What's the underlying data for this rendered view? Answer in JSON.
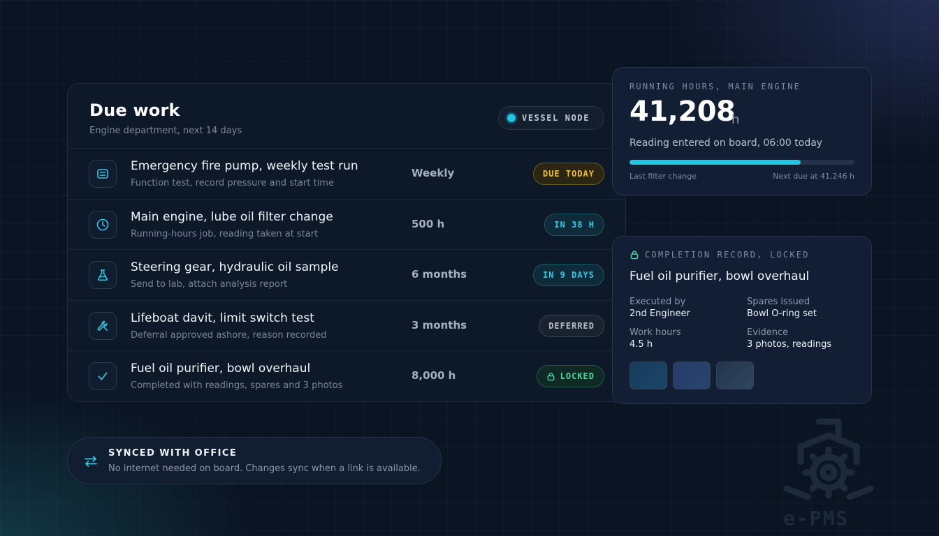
{
  "due_work": {
    "title": "Due work",
    "subtitle": "Engine department, next 14 days",
    "node_badge": "VESSEL NODE",
    "items": [
      {
        "icon": "list-icon",
        "title": "Emergency fire pump, weekly test run",
        "subtitle": "Function test, record pressure and start time",
        "interval": "Weekly",
        "status": "DUE TODAY",
        "status_type": "due"
      },
      {
        "icon": "clock-icon",
        "title": "Main engine, lube oil filter change",
        "subtitle": "Running-hours job, reading taken at start",
        "interval": "500 h",
        "status": "IN 38 H",
        "status_type": "in"
      },
      {
        "icon": "flask-icon",
        "title": "Steering gear, hydraulic oil sample",
        "subtitle": "Send to lab, attach analysis report",
        "interval": "6 months",
        "status": "IN 9 DAYS",
        "status_type": "in"
      },
      {
        "icon": "wrench-icon",
        "title": "Lifeboat davit, limit switch test",
        "subtitle": "Deferral approved ashore, reason recorded",
        "interval": "3 months",
        "status": "DEFERRED",
        "status_type": "deferred"
      },
      {
        "icon": "check-icon",
        "title": "Fuel oil purifier, bowl overhaul",
        "subtitle": "Completed with readings, spares and 3 photos",
        "interval": "8,000 h",
        "status": "LOCKED",
        "status_type": "locked"
      }
    ]
  },
  "running_hours": {
    "label": "RUNNING HOURS, MAIN ENGINE",
    "value": "41,208",
    "unit": "h",
    "note": "Reading entered on board, 06:00 today",
    "progress_fraction": 0.76,
    "progress_left": "Last filter change",
    "progress_right": "Next due at 41,246 h"
  },
  "completion_record": {
    "label": "COMPLETION RECORD, LOCKED",
    "title": "Fuel oil purifier, bowl overhaul",
    "fields": [
      {
        "label": "Executed by",
        "value": "2nd Engineer"
      },
      {
        "label": "Spares issued",
        "value": "Bowl O-ring set"
      },
      {
        "label": "Work hours",
        "value": "4.5 h"
      },
      {
        "label": "Evidence",
        "value": "3 photos, readings"
      }
    ]
  },
  "sync": {
    "title": "SYNCED WITH OFFICE",
    "text": "No internet needed on board. Changes sync when a link is available."
  },
  "logo": {
    "text": "e-PMS"
  },
  "colors": {
    "accent": "#21c6e0",
    "due": "#f2bd2e",
    "locked": "#4fd7a1",
    "background": "#0b1422"
  }
}
